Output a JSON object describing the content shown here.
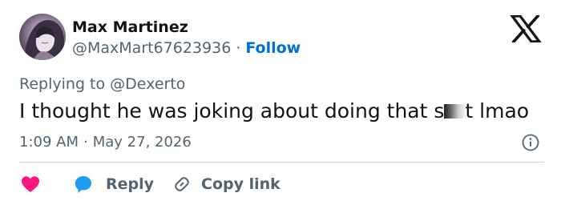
{
  "author": {
    "name": "Max Martinez",
    "handle": "@MaxMart67623936",
    "separator": "·",
    "follow_label": "Follow"
  },
  "tweet": {
    "replying_prefix": "Replying to",
    "replying_to": "@Dexerto",
    "text_before": "I thought he was joking about doing that s",
    "text_after": "t lmao",
    "time": "1:09 AM",
    "separator": "·",
    "date": "May 27, 2026"
  },
  "actions": {
    "reply_label": "Reply",
    "copy_link_label": "Copy link"
  },
  "colors": {
    "accent": "#006fd6",
    "like": "#f91880",
    "reply": "#1d9bf0",
    "muted_text": "#536471",
    "text": "#0f1419"
  },
  "icons": {
    "brand": "x-logo-icon",
    "info": "info-icon",
    "like": "heart-icon",
    "reply": "speech-bubble-icon",
    "copy_link": "link-icon"
  }
}
